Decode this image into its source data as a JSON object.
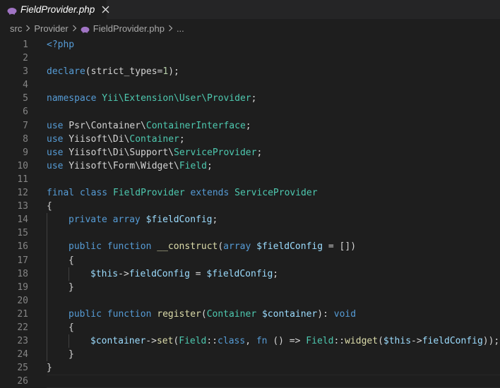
{
  "tab": {
    "label": "FieldProvider.php",
    "icon": "php-elephant-icon"
  },
  "breadcrumb": {
    "items": [
      "src",
      "Provider",
      "FieldProvider.php",
      "..."
    ]
  },
  "colors": {
    "background": "#1e1e1e",
    "keyword": "#569cd6",
    "function": "#dcdcaa",
    "type": "#4ec9b0",
    "variable": "#9cdcfe",
    "number": "#b5cea8",
    "text": "#d4d4d4",
    "line_number": "#858585",
    "php_icon": "#a074c4"
  },
  "code_lines": [
    {
      "n": "1",
      "indent": 0,
      "tokens": [
        [
          "kw",
          "<?php"
        ]
      ]
    },
    {
      "n": "2",
      "indent": 0,
      "tokens": []
    },
    {
      "n": "3",
      "indent": 0,
      "tokens": [
        [
          "kw",
          "declare"
        ],
        [
          "plain",
          "(strict_types="
        ],
        [
          "num",
          "1"
        ],
        [
          "plain",
          ");"
        ]
      ]
    },
    {
      "n": "4",
      "indent": 0,
      "tokens": []
    },
    {
      "n": "5",
      "indent": 0,
      "tokens": [
        [
          "kw",
          "namespace"
        ],
        [
          "plain",
          " "
        ],
        [
          "ty",
          "Yii\\Extension\\User\\Provider"
        ],
        [
          "plain",
          ";"
        ]
      ]
    },
    {
      "n": "6",
      "indent": 0,
      "tokens": []
    },
    {
      "n": "7",
      "indent": 0,
      "tokens": [
        [
          "kw",
          "use"
        ],
        [
          "plain",
          " Psr\\Container\\"
        ],
        [
          "ty",
          "ContainerInterface"
        ],
        [
          "plain",
          ";"
        ]
      ]
    },
    {
      "n": "8",
      "indent": 0,
      "tokens": [
        [
          "kw",
          "use"
        ],
        [
          "plain",
          " Yiisoft\\Di\\"
        ],
        [
          "ty",
          "Container"
        ],
        [
          "plain",
          ";"
        ]
      ]
    },
    {
      "n": "9",
      "indent": 0,
      "tokens": [
        [
          "kw",
          "use"
        ],
        [
          "plain",
          " Yiisoft\\Di\\Support\\"
        ],
        [
          "ty",
          "ServiceProvider"
        ],
        [
          "plain",
          ";"
        ]
      ]
    },
    {
      "n": "10",
      "indent": 0,
      "tokens": [
        [
          "kw",
          "use"
        ],
        [
          "plain",
          " Yiisoft\\Form\\Widget\\"
        ],
        [
          "ty",
          "Field"
        ],
        [
          "plain",
          ";"
        ]
      ]
    },
    {
      "n": "11",
      "indent": 0,
      "tokens": []
    },
    {
      "n": "12",
      "indent": 0,
      "tokens": [
        [
          "kw",
          "final"
        ],
        [
          "plain",
          " "
        ],
        [
          "kw",
          "class"
        ],
        [
          "plain",
          " "
        ],
        [
          "ty",
          "FieldProvider"
        ],
        [
          "plain",
          " "
        ],
        [
          "kw",
          "extends"
        ],
        [
          "plain",
          " "
        ],
        [
          "ty",
          "ServiceProvider"
        ]
      ]
    },
    {
      "n": "13",
      "indent": 0,
      "tokens": [
        [
          "plain",
          "{"
        ]
      ]
    },
    {
      "n": "14",
      "indent": 1,
      "tokens": [
        [
          "kw",
          "private"
        ],
        [
          "plain",
          " "
        ],
        [
          "kw",
          "array"
        ],
        [
          "plain",
          " "
        ],
        [
          "vr",
          "$fieldConfig"
        ],
        [
          "plain",
          ";"
        ]
      ]
    },
    {
      "n": "15",
      "indent": 1,
      "tokens": []
    },
    {
      "n": "16",
      "indent": 1,
      "tokens": [
        [
          "kw",
          "public"
        ],
        [
          "plain",
          " "
        ],
        [
          "kw",
          "function"
        ],
        [
          "plain",
          " "
        ],
        [
          "fn",
          "__construct"
        ],
        [
          "plain",
          "("
        ],
        [
          "kw",
          "array"
        ],
        [
          "plain",
          " "
        ],
        [
          "vr",
          "$fieldConfig"
        ],
        [
          "plain",
          " = [])"
        ]
      ]
    },
    {
      "n": "17",
      "indent": 1,
      "tokens": [
        [
          "plain",
          "{"
        ]
      ]
    },
    {
      "n": "18",
      "indent": 2,
      "tokens": [
        [
          "vr",
          "$this"
        ],
        [
          "plain",
          "->"
        ],
        [
          "vr",
          "fieldConfig"
        ],
        [
          "plain",
          " = "
        ],
        [
          "vr",
          "$fieldConfig"
        ],
        [
          "plain",
          ";"
        ]
      ]
    },
    {
      "n": "19",
      "indent": 1,
      "tokens": [
        [
          "plain",
          "}"
        ]
      ]
    },
    {
      "n": "20",
      "indent": 1,
      "tokens": []
    },
    {
      "n": "21",
      "indent": 1,
      "tokens": [
        [
          "kw",
          "public"
        ],
        [
          "plain",
          " "
        ],
        [
          "kw",
          "function"
        ],
        [
          "plain",
          " "
        ],
        [
          "fn",
          "register"
        ],
        [
          "plain",
          "("
        ],
        [
          "ty",
          "Container"
        ],
        [
          "plain",
          " "
        ],
        [
          "vr",
          "$container"
        ],
        [
          "plain",
          "): "
        ],
        [
          "kw",
          "void"
        ]
      ]
    },
    {
      "n": "22",
      "indent": 1,
      "tokens": [
        [
          "plain",
          "{"
        ]
      ]
    },
    {
      "n": "23",
      "indent": 2,
      "tokens": [
        [
          "vr",
          "$container"
        ],
        [
          "plain",
          "->"
        ],
        [
          "fn",
          "set"
        ],
        [
          "plain",
          "("
        ],
        [
          "ty",
          "Field"
        ],
        [
          "plain",
          "::"
        ],
        [
          "kw",
          "class"
        ],
        [
          "plain",
          ", "
        ],
        [
          "kw",
          "fn"
        ],
        [
          "plain",
          " () => "
        ],
        [
          "ty",
          "Field"
        ],
        [
          "plain",
          "::"
        ],
        [
          "fn",
          "widget"
        ],
        [
          "plain",
          "("
        ],
        [
          "vr",
          "$this"
        ],
        [
          "plain",
          "->"
        ],
        [
          "vr",
          "fieldConfig"
        ],
        [
          "plain",
          "));"
        ]
      ]
    },
    {
      "n": "24",
      "indent": 1,
      "tokens": [
        [
          "plain",
          "}"
        ]
      ]
    },
    {
      "n": "25",
      "indent": 0,
      "tokens": [
        [
          "plain",
          "}"
        ]
      ]
    },
    {
      "n": "26",
      "indent": 0,
      "tokens": []
    }
  ]
}
